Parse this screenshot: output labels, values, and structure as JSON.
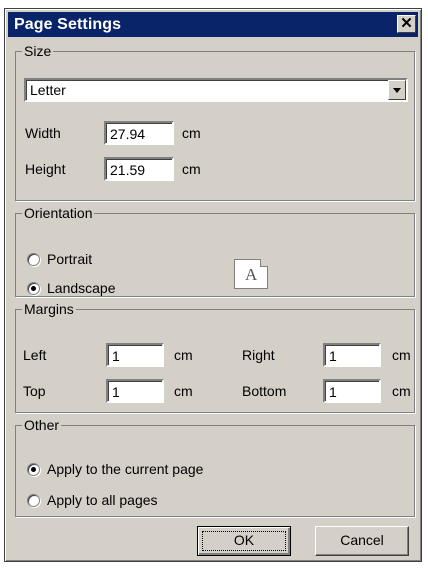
{
  "window": {
    "title": "Page Settings",
    "close_glyph": "✕"
  },
  "size": {
    "legend": "Size",
    "paper_selected": "Letter",
    "width_label": "Width",
    "width_value": "27.94",
    "width_unit": "cm",
    "height_label": "Height",
    "height_value": "21.59",
    "height_unit": "cm"
  },
  "orientation": {
    "legend": "Orientation",
    "options": [
      {
        "label": "Portrait",
        "checked": false
      },
      {
        "label": "Landscape",
        "checked": true
      }
    ],
    "preview_letter": "A"
  },
  "margins": {
    "legend": "Margins",
    "left_label": "Left",
    "left_value": "1",
    "left_unit": "cm",
    "right_label": "Right",
    "right_value": "1",
    "right_unit": "cm",
    "top_label": "Top",
    "top_value": "1",
    "top_unit": "cm",
    "bottom_label": "Bottom",
    "bottom_value": "1",
    "bottom_unit": "cm"
  },
  "other": {
    "legend": "Other",
    "options": [
      {
        "label": "Apply to the current page",
        "checked": true
      },
      {
        "label": "Apply to all pages",
        "checked": false
      }
    ]
  },
  "buttons": {
    "ok_label": "OK",
    "cancel_label": "Cancel"
  },
  "colors": {
    "titlebar": "#0a246a",
    "face": "#d4d0c8",
    "field": "#ffffff"
  }
}
